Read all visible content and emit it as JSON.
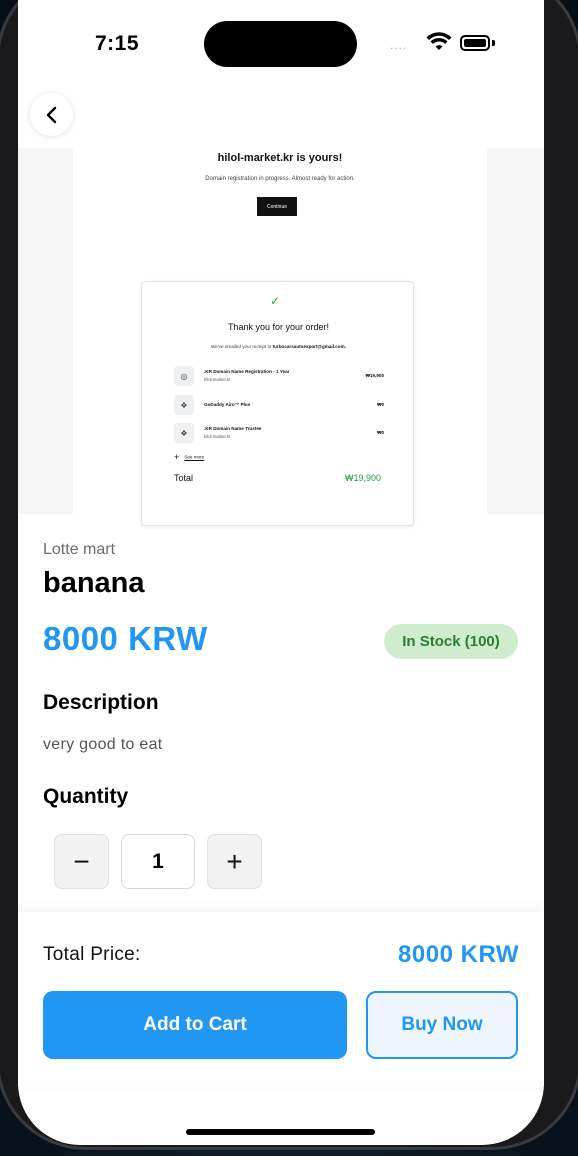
{
  "status_bar": {
    "time": "7:15",
    "signal": "...."
  },
  "receipt_image": {
    "title": "hilol-market.kr is yours!",
    "subtitle": "Domain registration in progress. Almost ready for action.",
    "continue_label": "Continue",
    "card": {
      "check_glyph": "✓",
      "thank_you": "Thank you for your order!",
      "emailed_prefix": "We've emailed your receipt to ",
      "emailed_address": "turbocarsautoexport@gmail.com.",
      "items": [
        {
          "icon": "globe-icon",
          "glyph": "◎",
          "name": ".KR Domain Name Registration - 1 Year",
          "sub": "hilol-market.kr",
          "price": "₩19,900"
        },
        {
          "icon": "shield-icon",
          "glyph": "❖",
          "name": "GoDaddy Airo™ Plus",
          "sub": "",
          "price": "₩0"
        },
        {
          "icon": "shield-icon",
          "glyph": "❖",
          "name": ".KR Domain Name Trustee",
          "sub": "hilol-market.kr",
          "price": "₩0"
        }
      ],
      "see_more": "See more",
      "total_label": "Total",
      "total_value": "₩19,900"
    }
  },
  "product": {
    "store": "Lotte mart",
    "name": "banana",
    "price": "8000 KRW",
    "stock_badge": "In Stock (100)",
    "description_heading": "Description",
    "description": "very good to eat",
    "quantity_heading": "Quantity",
    "quantity": "1",
    "decrement": "−",
    "increment": "+"
  },
  "footer": {
    "total_label": "Total Price:",
    "total_value": "8000 KRW",
    "add_to_cart": "Add to Cart",
    "buy_now": "Buy Now"
  },
  "colors": {
    "accent": "#2196f3",
    "stock_bg": "#cfeccf",
    "stock_text": "#2e7d32",
    "receipt_green": "#1b9e3e"
  }
}
